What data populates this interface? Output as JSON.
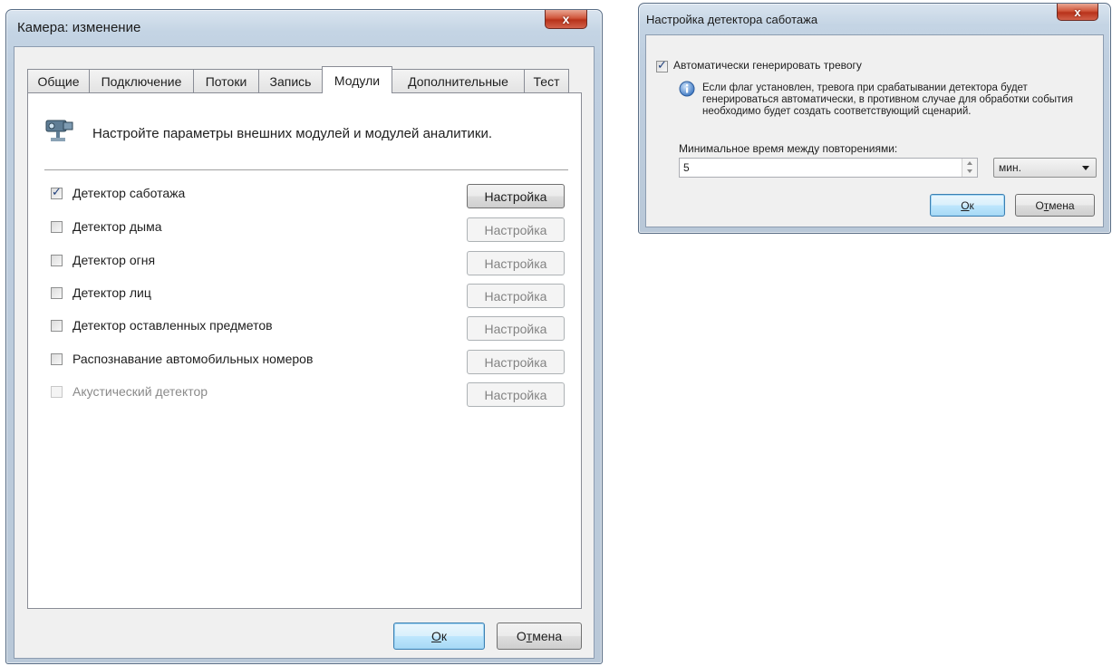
{
  "camera_dialog": {
    "title": "Камера: изменение",
    "close_label": "x",
    "tabs": [
      {
        "label": "Общие",
        "active": false
      },
      {
        "label": "Подключение",
        "active": false
      },
      {
        "label": "Потоки",
        "active": false
      },
      {
        "label": "Запись",
        "active": false
      },
      {
        "label": "Модули",
        "active": true
      },
      {
        "label": "Дополнительные",
        "active": false
      },
      {
        "label": "Тест",
        "active": false
      }
    ],
    "header_icon": "camera-icon",
    "header_text": "Настройте параметры внешних модулей и модулей аналитики.",
    "modules": [
      {
        "label": "Детектор саботажа",
        "checked": true,
        "enabled": true,
        "button": "Настройка",
        "button_enabled": true
      },
      {
        "label": "Детектор дыма",
        "checked": false,
        "enabled": true,
        "button": "Настройка",
        "button_enabled": false
      },
      {
        "label": "Детектор огня",
        "checked": false,
        "enabled": true,
        "button": "Настройка",
        "button_enabled": false
      },
      {
        "label": "Детектор лиц",
        "checked": false,
        "enabled": true,
        "button": "Настройка",
        "button_enabled": false
      },
      {
        "label": "Детектор оставленных предметов",
        "checked": false,
        "enabled": true,
        "button": "Настройка",
        "button_enabled": false
      },
      {
        "label": "Распознавание автомобильных номеров",
        "checked": false,
        "enabled": true,
        "button": "Настройка",
        "button_enabled": false
      },
      {
        "label": "Акустический детектор",
        "checked": false,
        "enabled": false,
        "button": "Настройка",
        "button_enabled": false
      }
    ],
    "ok_label_mnemonic": "О",
    "ok_label_rest": "к",
    "cancel_label_first": "О",
    "cancel_label_mnemonic": "т",
    "cancel_label_rest": "мена"
  },
  "sabotage_dialog": {
    "title": "Настройка детектора саботажа",
    "close_label": "x",
    "auto_alarm_label": "Автоматически генерировать тревогу",
    "auto_alarm_checked": true,
    "info_icon": "info-icon",
    "info_text": "Если флаг установлен, тревога при срабатывании детектора будет генерироваться автоматически, в противном случае для обработки события необходимо будет создать соответствующий сценарий.",
    "interval_label": "Минимальное время между повторениями:",
    "interval_value": "5",
    "unit_value": "мин.",
    "ok_label_mnemonic": "О",
    "ok_label_rest": "к",
    "cancel_label_first": "О",
    "cancel_label_mnemonic": "т",
    "cancel_label_rest": "мена"
  },
  "colors": {
    "frame": "#bfcfe0",
    "client": "#f0f0f0",
    "close_button": "#c7432a",
    "default_button": "#bee6fd",
    "checkmark": "#21417d"
  }
}
